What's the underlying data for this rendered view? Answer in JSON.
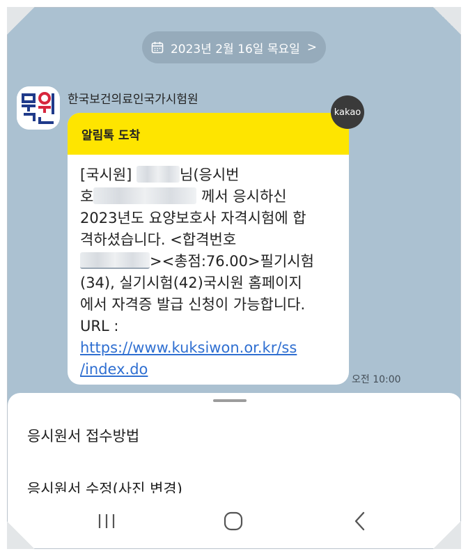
{
  "date_bar": {
    "text": "2023년 2월 16일 목요일",
    "chevron": ">"
  },
  "sender": {
    "name": "한국보건의료인국가시험원",
    "avatar_icon": "kuksiwon-logo-icon"
  },
  "message": {
    "header": "알림톡 도착",
    "badge": "kakao",
    "time": "오전 10:00",
    "lines": {
      "l1a": "[국시원] ",
      "l1b": "님(응시번",
      "l2a": "호",
      "l2b": " 께서 응시하신",
      "l3": "2023년도 요양보호사 자격시험에 합",
      "l4": "격하셨습니다. <합격번호",
      "l5b": "><총점:76.00>필기시험",
      "l6": "(34), 실기시험(42)국시원 홈페이지",
      "l7": "에서 자격증 발급 신청이 가능합니다.",
      "l8": "URL :",
      "link1": "https://www.kuksiwon.or.kr/ss",
      "link2": "/index.do"
    }
  },
  "sheet": {
    "items": [
      {
        "label": "응시원서 접수방법"
      },
      {
        "label": "응시원서 수정(사진 변경)"
      }
    ]
  },
  "colors": {
    "chat_bg": "#abc1d1",
    "header_yellow": "#fee500",
    "link": "#2f6fd1"
  }
}
